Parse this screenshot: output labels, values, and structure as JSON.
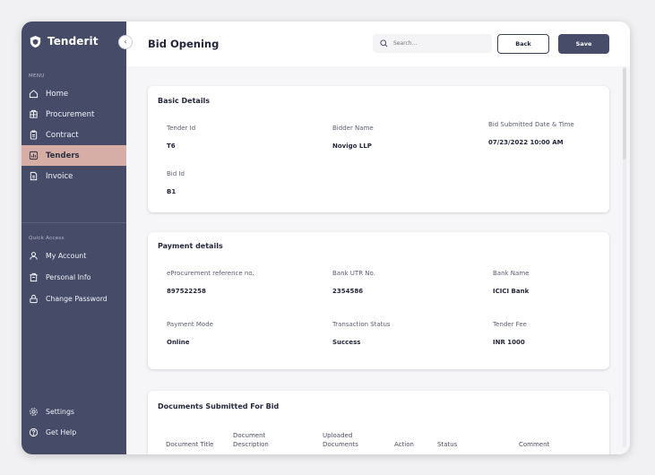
{
  "app": {
    "name": "Tenderit",
    "collapse_icon": "chevron-left-icon"
  },
  "sidebar": {
    "menu_label": "MENU",
    "menu_items": [
      {
        "label": "Home",
        "icon": "home-icon"
      },
      {
        "label": "Procurement",
        "icon": "procurement-icon"
      },
      {
        "label": "Contract",
        "icon": "contract-icon"
      },
      {
        "label": "Tenders",
        "icon": "tenders-icon",
        "active": true
      },
      {
        "label": "Invoice",
        "icon": "invoice-icon"
      }
    ],
    "quick_label": "Quick Access",
    "quick_items": [
      {
        "label": "My Account",
        "icon": "user-icon"
      },
      {
        "label": "Personal Info",
        "icon": "personal-info-icon"
      },
      {
        "label": "Change Password",
        "icon": "lock-icon"
      }
    ],
    "footer_items": [
      {
        "label": "Settings",
        "icon": "gear-icon"
      },
      {
        "label": "Get Help",
        "icon": "help-icon"
      }
    ]
  },
  "header": {
    "title": "Bid Opening",
    "search_placeholder": "Search...",
    "back_label": "Back",
    "save_label": "Save"
  },
  "basic_details": {
    "title": "Basic Details",
    "tender_id_label": "Tender Id",
    "tender_id": "T6",
    "bidder_name_label": "Bidder Name",
    "bidder_name": "Novigo LLP",
    "submitted_label": "Bid Submitted Date & Time",
    "submitted": "07/23/2022 10:00 AM",
    "bid_id_label": "Bid Id",
    "bid_id": "B1"
  },
  "payment_details": {
    "title": "Payment details",
    "ref_label": "eProcurement reference no.",
    "ref": "897522258",
    "utr_label": "Bank UTR No.",
    "utr": "2354586",
    "bank_label": "Bank Name",
    "bank": "ICICI Bank",
    "mode_label": "Payment Mode",
    "mode": "Online",
    "status_label": "Transaction Status",
    "status": "Success",
    "fee_label": "Tender Fee",
    "fee": "INR 1000"
  },
  "documents": {
    "title": "Documents Submitted For Bid",
    "columns": [
      "Document Title",
      "Document\nDescription",
      "Uploaded\nDocuments",
      "Action",
      "Status",
      "Comment"
    ]
  },
  "colors": {
    "sidebar": "#464b68",
    "active_item": "#d6aea6",
    "primary_button": "#474c68"
  }
}
